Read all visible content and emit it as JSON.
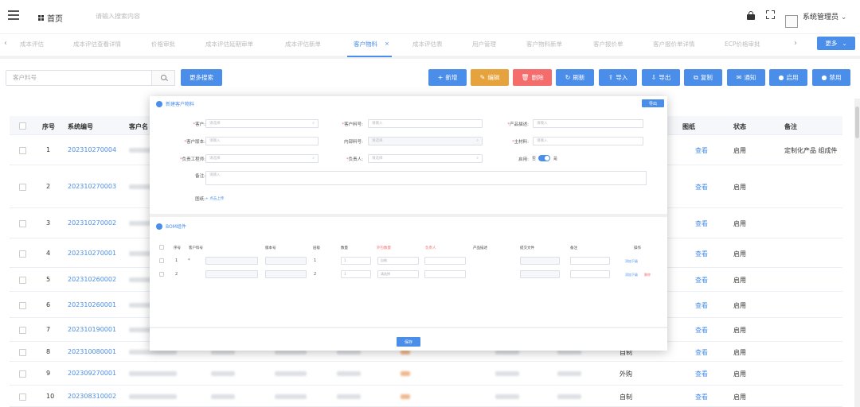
{
  "topbar": {
    "home_label": "首页",
    "search_placeholder": "请输入搜索内容",
    "username": "系统管理员"
  },
  "tabs": [
    {
      "label": "成本评估"
    },
    {
      "label": "成本评估查看详情"
    },
    {
      "label": "价格审批"
    },
    {
      "label": "成本评估延期审单"
    },
    {
      "label": "成本评估新单"
    },
    {
      "label": "客户物料",
      "active": true
    },
    {
      "label": "成本评估表"
    },
    {
      "label": "用户管理"
    },
    {
      "label": "客户物料新单"
    },
    {
      "label": "客户报价单"
    },
    {
      "label": "客户报价单详情"
    },
    {
      "label": "ECP价格审批"
    }
  ],
  "more_tabs_label": "更多",
  "toolbar": {
    "search_placeholder": "客户料号",
    "more_search_label": "更多搜索",
    "buttons": [
      {
        "label": "新增",
        "glyph": "+",
        "color": "blue"
      },
      {
        "label": "编辑",
        "glyph": "✎",
        "color": "orange"
      },
      {
        "label": "删除",
        "glyph": "🗑",
        "color": "red"
      },
      {
        "label": "刷新",
        "glyph": "↻",
        "color": "blue"
      },
      {
        "label": "导入",
        "glyph": "⇪",
        "color": "blue"
      },
      {
        "label": "导出",
        "glyph": "⇩",
        "color": "blue"
      },
      {
        "label": "复制",
        "glyph": "⧉",
        "color": "blue"
      },
      {
        "label": "通知",
        "glyph": "✉",
        "color": "blue"
      },
      {
        "label": "启用",
        "glyph": "●",
        "color": "blue"
      },
      {
        "label": "禁用",
        "glyph": "●",
        "color": "blue"
      }
    ]
  },
  "table": {
    "headers": {
      "index": "序号",
      "code": "系统编号",
      "customer": "客户名",
      "drawing": "图纸",
      "status": "状态",
      "remark": "备注"
    },
    "rows": [
      {
        "index": "1",
        "code": "202310270004",
        "drawing": "查看",
        "status": "启用",
        "remark": "定制化产品 组成件"
      },
      {
        "index": "2",
        "code": "202310270003",
        "drawing": "查看",
        "status": "启用",
        "remark": ""
      },
      {
        "index": "3",
        "code": "202310270002",
        "drawing": "查看",
        "status": "启用",
        "remark": ""
      },
      {
        "index": "4",
        "code": "202310270001",
        "drawing": "查看",
        "status": "启用",
        "remark": ""
      },
      {
        "index": "5",
        "code": "202310260002",
        "drawing": "查看",
        "status": "启用",
        "remark": ""
      },
      {
        "index": "6",
        "code": "202310260001",
        "drawing": "查看",
        "status": "启用",
        "remark": ""
      },
      {
        "index": "7",
        "code": "202310190001",
        "drawing": "查看",
        "status": "启用",
        "remark": ""
      },
      {
        "index": "8",
        "code": "202310080001",
        "drawing": "查看",
        "status": "启用",
        "remark": "",
        "type": "自制"
      },
      {
        "index": "9",
        "code": "202309270001",
        "drawing": "查看",
        "status": "启用",
        "remark": "",
        "type": "外购"
      },
      {
        "index": "10",
        "code": "202308310002",
        "drawing": "查看",
        "status": "启用",
        "remark": "",
        "type": "自制"
      }
    ]
  },
  "dialog": {
    "title": "新建客户物料",
    "export_label": "导出",
    "fields": {
      "customer": {
        "label": "客户:",
        "placeholder": "请选择"
      },
      "customer_part_no": {
        "label": "客户料号:",
        "placeholder": "请输入"
      },
      "product_spec": {
        "label": "产品描述:",
        "placeholder": "请输入"
      },
      "customer_version": {
        "label": "客户版本:",
        "placeholder": "请输入"
      },
      "internal_part_no": {
        "label": "内部料号:",
        "placeholder": "请选择"
      },
      "main_material": {
        "label": "主材料:",
        "placeholder": "请输入"
      },
      "process_engineer": {
        "label": "负责工程师:",
        "placeholder": "请选择"
      },
      "owner": {
        "label": "负责人:",
        "placeholder": "请选择"
      },
      "enabled": {
        "label": "启用:",
        "off": "否",
        "on": "是"
      },
      "remark": {
        "label": "备注:",
        "placeholder": "请输入"
      },
      "drawing": {
        "label": "图纸:",
        "upload": "+ 点击上传"
      }
    },
    "bom": {
      "title": "BOM组件",
      "headers": [
        "序号",
        "客户料号",
        "版本号",
        "层级",
        "数量",
        "外包数量",
        "负责人",
        "产品描述",
        "提交文件",
        "备注",
        "操作"
      ],
      "rows": [
        {
          "index": "1",
          "marker": "*",
          "level": "1",
          "qty": "1",
          "outsource": "自制",
          "ops": [
            "添加下级"
          ]
        },
        {
          "index": "2",
          "marker": "",
          "level": "2",
          "qty": "1",
          "outsource": "请选择",
          "ops": [
            "添加下级",
            "删除"
          ]
        }
      ]
    },
    "save_label": "保存"
  }
}
